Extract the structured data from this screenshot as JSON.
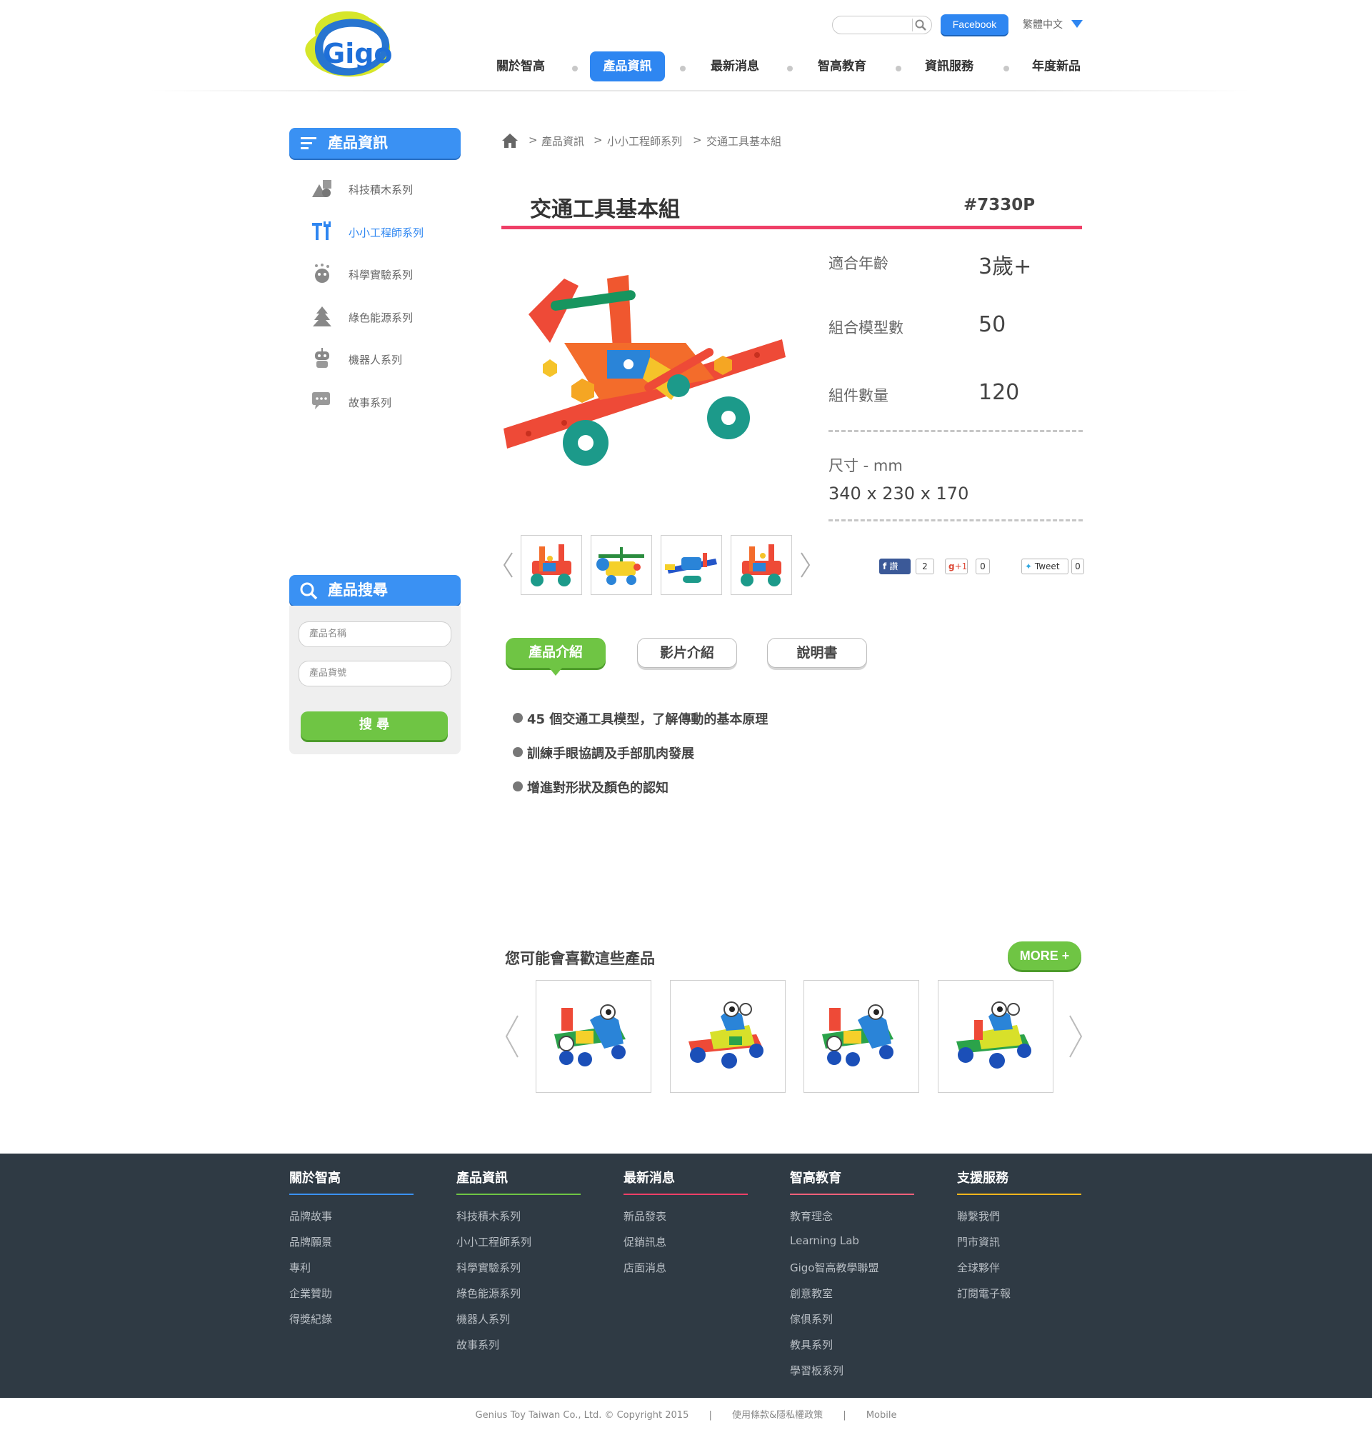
{
  "header": {
    "logo_text": "Gigo",
    "search_placeholder": "",
    "facebook_label": "Facebook",
    "language_label": "繁體中文",
    "nav": [
      {
        "label": "關於智高",
        "active": false
      },
      {
        "label": "產品資訊",
        "active": true
      },
      {
        "label": "最新消息",
        "active": false
      },
      {
        "label": "智高教育",
        "active": false
      },
      {
        "label": "資訊服務",
        "active": false
      },
      {
        "label": "年度新品",
        "active": false
      }
    ]
  },
  "sidebar": {
    "title": "產品資訊",
    "categories": [
      {
        "label": "科技積木系列",
        "icon": "shapes-icon"
      },
      {
        "label": "小小工程師系列",
        "icon": "tools-icon",
        "active": true
      },
      {
        "label": "科學實驗系列",
        "icon": "science-icon"
      },
      {
        "label": "綠色能源系列",
        "icon": "tree-icon"
      },
      {
        "label": "機器人系列",
        "icon": "robot-icon"
      },
      {
        "label": "故事系列",
        "icon": "chat-bubble-icon"
      }
    ],
    "search": {
      "title": "產品搜尋",
      "name_placeholder": "產品名稱",
      "code_placeholder": "產品貨號",
      "button_label": "搜 尋"
    }
  },
  "breadcrumb": {
    "sep": ">",
    "items": [
      "產品資訊",
      "小小工程師系列",
      "交通工具基本組"
    ]
  },
  "product": {
    "title": "交通工具基本組",
    "code": "#7330P",
    "specs": {
      "age_label": "適合年齡",
      "age_value": "3歲+",
      "models_label": "組合模型數",
      "models_value": "50",
      "parts_label": "組件數量",
      "parts_value": "120",
      "size_label": "尺寸 - mm",
      "size_value": "340 x 230 x 170"
    },
    "social": {
      "fb_label": "讚",
      "fb_count": "2",
      "gplus_label": "+1",
      "gplus_count": "0",
      "tweet_label": "Tweet",
      "tweet_count": "0"
    },
    "tabs": [
      {
        "label": "產品介紹",
        "active": true
      },
      {
        "label": "影片介紹",
        "active": false
      },
      {
        "label": "說明書",
        "active": false
      }
    ],
    "features": [
      "45 個交通工具模型，了解傳動的基本原理",
      "訓練手眼協調及手部肌肉發展",
      "增進對形狀及顏色的認知"
    ]
  },
  "related": {
    "title": "您可能會喜歡這些產品",
    "more_label": "MORE +"
  },
  "footer": {
    "columns": [
      {
        "title": "關於智高",
        "color": "#3a91f3",
        "items": [
          "品牌故事",
          "品牌願景",
          "專利",
          "企業贊助",
          "得獎紀錄"
        ]
      },
      {
        "title": "產品資訊",
        "color": "#6fc544",
        "items": [
          "科技積木系列",
          "小小工程師系列",
          "科學實驗系列",
          "綠色能源系列",
          "機器人系列",
          "故事系列"
        ]
      },
      {
        "title": "最新消息",
        "color": "#ef3f67",
        "items": [
          "新品發表",
          "促銷訊息",
          "店面消息"
        ]
      },
      {
        "title": "智高教育",
        "color": "#f0607a",
        "items": [
          "教育理念",
          "Learning Lab",
          "Gigo智高教學聯盟",
          "創意教室",
          "傢俱系列",
          "教具系列",
          "學習板系列"
        ]
      },
      {
        "title": "支援服務",
        "color": "#f5b51c",
        "items": [
          "聯繫我們",
          "門市資訊",
          "全球夥伴",
          "訂閱電子報"
        ]
      }
    ],
    "copyright": "Genius Toy Taiwan Co., Ltd. © Copyright 2015",
    "sep": "|",
    "policy": "使用條款&隱私權政策",
    "mobile": "Mobile"
  }
}
